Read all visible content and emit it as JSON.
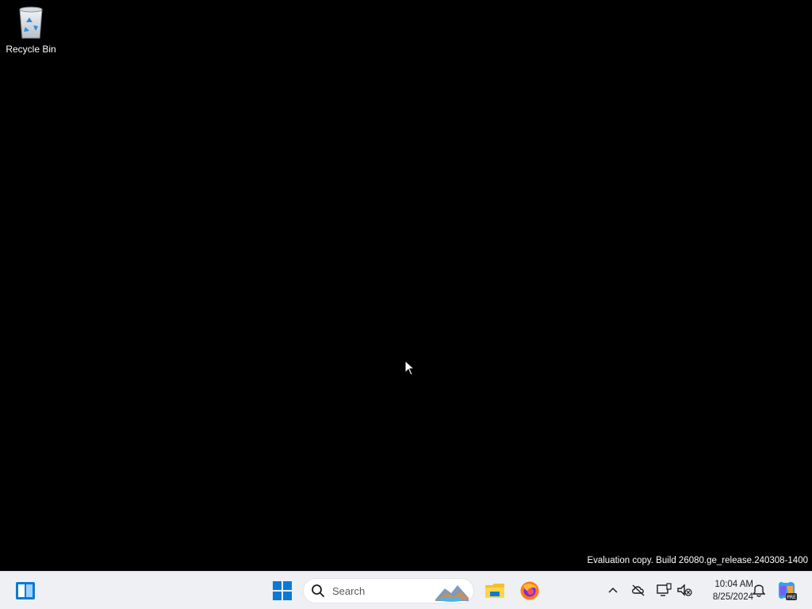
{
  "desktop": {
    "icons": [
      {
        "label": "Recycle Bin",
        "icon": "recycle-bin-icon"
      }
    ],
    "watermark": "Evaluation copy. Build 26080.ge_release.240308-1400"
  },
  "taskbar": {
    "widgets_icon": "widgets-icon",
    "start_icon": "windows-start-icon",
    "search": {
      "placeholder": "Search",
      "icon": "search-icon"
    },
    "pinned": [
      {
        "name": "File Explorer",
        "icon": "file-explorer-icon"
      },
      {
        "name": "Firefox",
        "icon": "firefox-icon"
      }
    ],
    "tray": {
      "icons": [
        "chevron-up-icon",
        "onedrive-offline-icon",
        "network-icon",
        "volume-muted-icon"
      ],
      "time": "10:04 AM",
      "date": "8/25/2024",
      "notification_icon": "bell-icon",
      "copilot_icon": "copilot-pre-icon"
    }
  },
  "colors": {
    "desktop_bg": "#000000",
    "taskbar_bg": "#eef0f3",
    "windows_blue": "#0a7ad6"
  }
}
